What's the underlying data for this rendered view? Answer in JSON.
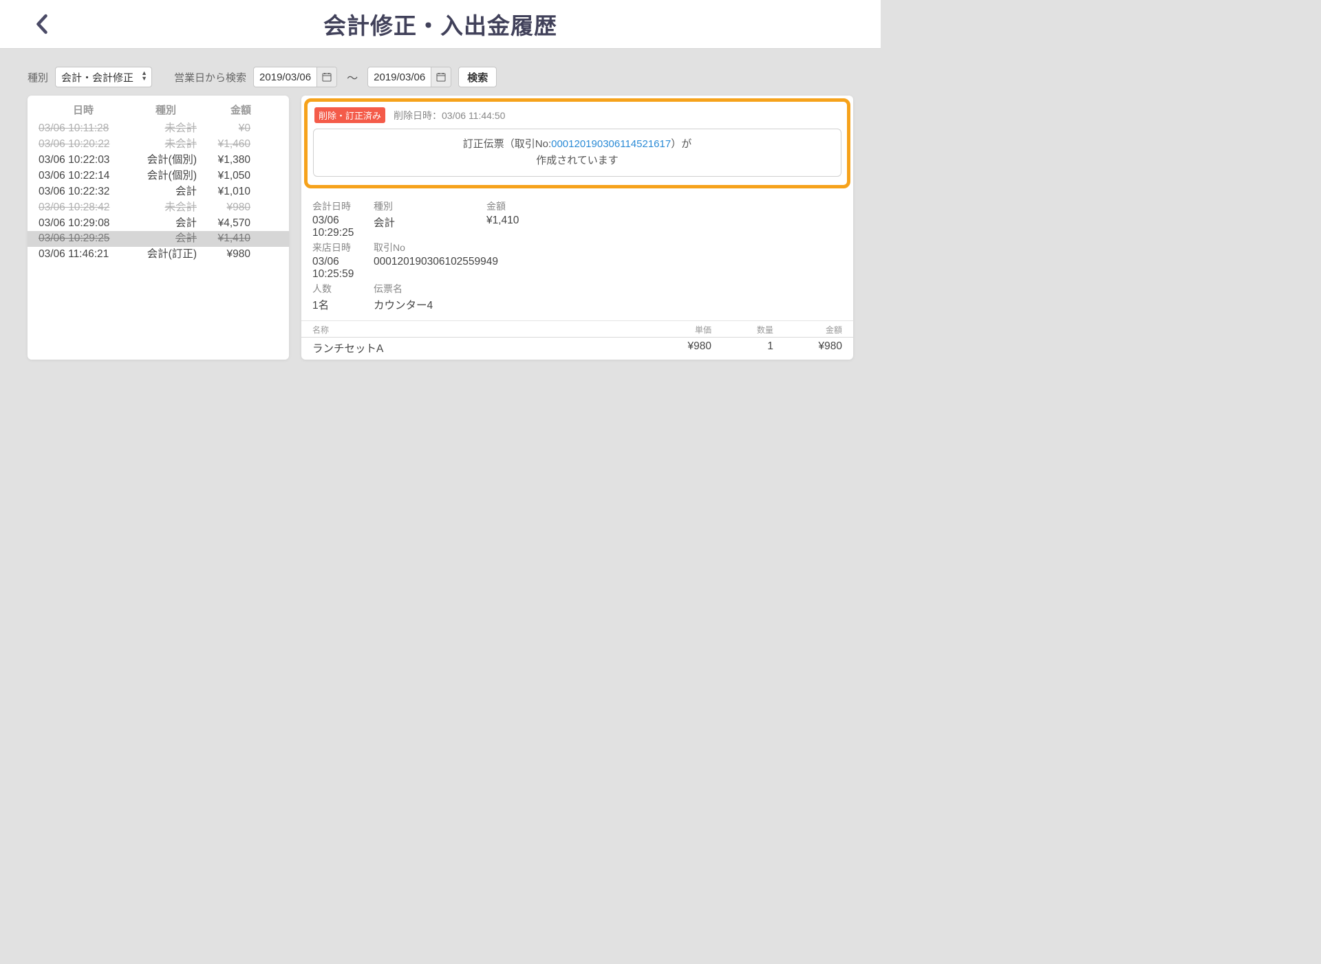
{
  "header": {
    "title": "会計修正・入出金履歴"
  },
  "filter": {
    "type_label": "種別",
    "type_value": "会計・会計修正",
    "date_label": "営業日から検索",
    "date_from": "2019/03/06",
    "date_to": "2019/03/06",
    "tilde": "〜",
    "search_label": "検索"
  },
  "list": {
    "head_date": "日時",
    "head_type": "種別",
    "head_amount": "金額",
    "rows": [
      {
        "date": "03/06 10:11:28",
        "type": "未会計",
        "amount": "¥0",
        "struck": true,
        "selected": false
      },
      {
        "date": "03/06 10:20:22",
        "type": "未会計",
        "amount": "¥1,460",
        "struck": true,
        "selected": false
      },
      {
        "date": "03/06 10:22:03",
        "type": "会計(個別)",
        "amount": "¥1,380",
        "struck": false,
        "selected": false
      },
      {
        "date": "03/06 10:22:14",
        "type": "会計(個別)",
        "amount": "¥1,050",
        "struck": false,
        "selected": false
      },
      {
        "date": "03/06 10:22:32",
        "type": "会計",
        "amount": "¥1,010",
        "struck": false,
        "selected": false
      },
      {
        "date": "03/06 10:28:42",
        "type": "未会計",
        "amount": "¥980",
        "struck": true,
        "selected": false
      },
      {
        "date": "03/06 10:29:08",
        "type": "会計",
        "amount": "¥4,570",
        "struck": false,
        "selected": false
      },
      {
        "date": "03/06 10:29:25",
        "type": "会計",
        "amount": "¥1,410",
        "struck": true,
        "selected": true
      },
      {
        "date": "03/06 11:46:21",
        "type": "会計(訂正)",
        "amount": "¥980",
        "struck": false,
        "selected": false
      }
    ]
  },
  "detail": {
    "badge": "削除・訂正済み",
    "delete_time_label": "削除日時：",
    "delete_time_value": "03/06 11:44:50",
    "notice_pre": "訂正伝票（取引No:",
    "notice_no": "00012019030611452​1617",
    "notice_post": "）が",
    "notice_line2": "作成されています",
    "labels": {
      "kaikei_date": "会計日時",
      "type": "種別",
      "amount": "金額",
      "visit_date": "来店日時",
      "trans_no": "取引No",
      "people": "人数",
      "slip_name": "伝票名"
    },
    "values": {
      "kaikei_date": "03/06 10:29:25",
      "type": "会計",
      "amount": "¥1,410",
      "visit_date": "03/06 10:25:59",
      "trans_no": "00012019030610255​9949",
      "people": "1名",
      "slip_name": "カウンター4"
    },
    "items_head": {
      "name": "名称",
      "price": "単価",
      "qty": "数量",
      "amount": "金額"
    },
    "items": [
      {
        "name": "ランチセットA",
        "price": "¥980",
        "qty": "1",
        "amount": "¥980"
      }
    ]
  }
}
